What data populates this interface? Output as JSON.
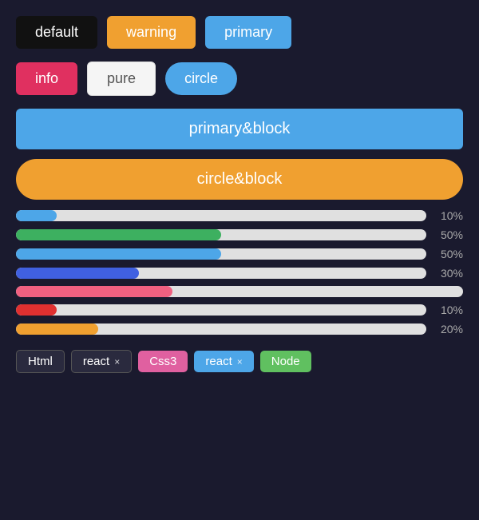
{
  "buttons": {
    "row1": [
      {
        "label": "default",
        "style": "btn-default",
        "name": "default-button"
      },
      {
        "label": "warning",
        "style": "btn-warning",
        "name": "warning-button"
      },
      {
        "label": "primary",
        "style": "btn-primary",
        "name": "primary-button"
      }
    ],
    "row2": [
      {
        "label": "info",
        "style": "btn-info",
        "name": "info-button"
      },
      {
        "label": "pure",
        "style": "btn-pure",
        "name": "pure-button"
      },
      {
        "label": "circle",
        "style": "btn-circle",
        "name": "circle-button"
      }
    ],
    "primaryBlock": "primary&block",
    "circleBlock": "circle&block"
  },
  "progressBars": [
    {
      "color": "#4da6e8",
      "percent": 10,
      "showLabel": true,
      "label": "10%"
    },
    {
      "color": "#3db060",
      "percent": 50,
      "showLabel": true,
      "label": "50%"
    },
    {
      "color": "#4da6e8",
      "percent": 50,
      "showLabel": true,
      "label": "50%"
    },
    {
      "color": "#4060e0",
      "percent": 30,
      "showLabel": true,
      "label": "30%"
    },
    {
      "color": "#f06080",
      "percent": 35,
      "showLabel": false,
      "label": ""
    },
    {
      "color": "#e03030",
      "percent": 10,
      "showLabel": true,
      "label": "10%"
    },
    {
      "color": "#f0a030",
      "percent": 20,
      "showLabel": true,
      "label": "20%"
    }
  ],
  "tags": [
    {
      "label": "Html",
      "style": "tag-default",
      "hasClose": false,
      "name": "tag-html"
    },
    {
      "label": "react",
      "style": "tag-react",
      "hasClose": true,
      "name": "tag-react1"
    },
    {
      "label": "Css3",
      "style": "tag-css3",
      "hasClose": false,
      "name": "tag-css3"
    },
    {
      "label": "react",
      "style": "tag-react2",
      "hasClose": true,
      "name": "tag-react2"
    },
    {
      "label": "Node",
      "style": "tag-node",
      "hasClose": false,
      "name": "tag-node"
    }
  ],
  "colors": {
    "bg": "#1a1a2e",
    "trackBg": "#e0e0e0"
  }
}
